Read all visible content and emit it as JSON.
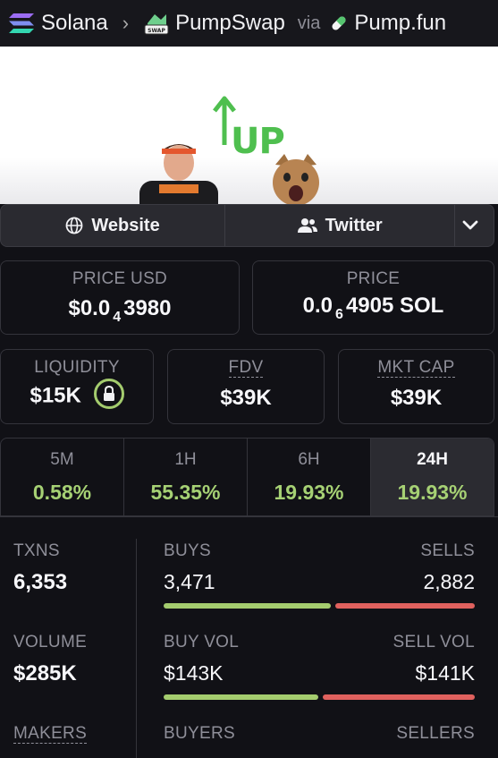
{
  "breadcrumb": {
    "chain": "Solana",
    "dex": "PumpSwap",
    "via": "via",
    "launchpad": "Pump.fun"
  },
  "banner": {
    "text": "UP"
  },
  "links": {
    "website": "Website",
    "twitter": "Twitter"
  },
  "price_usd": {
    "label": "PRICE USD",
    "prefix": "$0.0",
    "sub": "4",
    "suffix": "3980"
  },
  "price": {
    "label": "PRICE",
    "prefix": "0.0",
    "sub": "6",
    "suffix": "4905 SOL"
  },
  "liquidity": {
    "label": "LIQUIDITY",
    "value": "$15K"
  },
  "fdv": {
    "label": "FDV",
    "value": "$39K"
  },
  "mkt_cap": {
    "label": "MKT CAP",
    "value": "$39K"
  },
  "timeframes": [
    {
      "label": "5M",
      "change": "0.58%"
    },
    {
      "label": "1H",
      "change": "55.35%"
    },
    {
      "label": "6H",
      "change": "19.93%"
    },
    {
      "label": "24H",
      "change": "19.93%"
    }
  ],
  "active_timeframe": "24H",
  "stats": {
    "txns": {
      "label": "TXNS",
      "value": "6,353"
    },
    "buys": {
      "label": "BUYS",
      "value": "3,471"
    },
    "sells": {
      "label": "SELLS",
      "value": "2,882"
    },
    "buys_share": 0.546,
    "volume": {
      "label": "VOLUME",
      "value": "$285K"
    },
    "buy_vol": {
      "label": "BUY VOL",
      "value": "$143K"
    },
    "sell_vol": {
      "label": "SELL VOL",
      "value": "$141K"
    },
    "buy_vol_share": 0.503,
    "makers": {
      "label": "MAKERS"
    },
    "buyers": {
      "label": "BUYERS"
    },
    "sellers": {
      "label": "SELLERS"
    }
  },
  "colors": {
    "positive": "#a6d174",
    "sell": "#e0615e",
    "background": "#111116"
  }
}
